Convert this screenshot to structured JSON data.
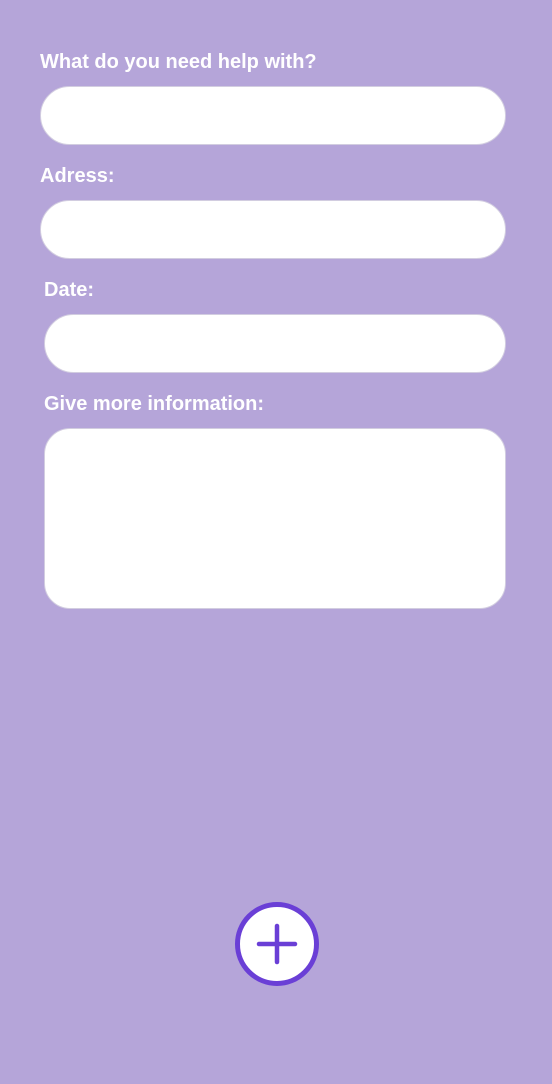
{
  "form": {
    "help_label": "What do you need help with?",
    "help_value": "",
    "address_label": "Adress:",
    "address_value": "",
    "date_label": "Date:",
    "date_value": "",
    "info_label": "Give more information:",
    "info_value": ""
  },
  "add_button": {
    "icon": "plus-icon"
  },
  "colors": {
    "background": "#b5a5d9",
    "accent": "#6a3fd6",
    "field": "#ffffff",
    "label": "#ffffff"
  }
}
